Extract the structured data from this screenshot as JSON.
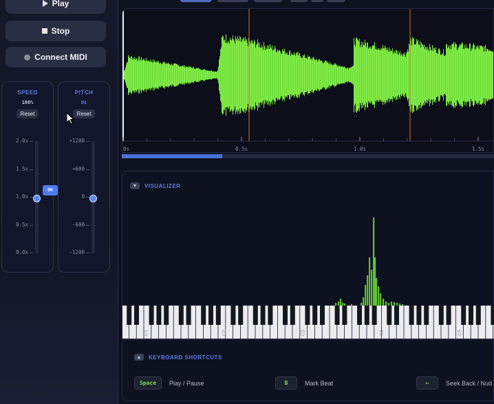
{
  "transport": {
    "play_label": "Play",
    "stop_label": "Stop",
    "midi_label": "Connect MIDI"
  },
  "speed": {
    "title": "SPEED",
    "value": "100%",
    "reset_label": "Reset",
    "ticks": [
      "2.0x",
      "1.5x",
      "1.0x",
      "0.5x",
      "0.0x"
    ],
    "level": 0.5
  },
  "pitch": {
    "title": "PITCH",
    "value": "0¢",
    "reset_label": "Reset",
    "badge": "0¢",
    "ticks": [
      "+1200",
      "+600",
      "0",
      "-600",
      "-1200"
    ],
    "level": 0.5
  },
  "waveform": {
    "time_labels": [
      "0s",
      "0.5s",
      "1.0s",
      "1.5s"
    ],
    "progress": 0.27,
    "colors": {
      "wave": "#6fdf3a",
      "wave_light": "#8ff04f",
      "marker": "#d9782a"
    }
  },
  "visualizer": {
    "title": "VISUALIZER",
    "toggle": "▼",
    "octave_labels": [
      "C1",
      "C2",
      "C3",
      "C4",
      "C5"
    ]
  },
  "shortcuts": {
    "title": "KEYBOARD SHORTCUTS",
    "toggle": "▲",
    "items": [
      {
        "key": "Space",
        "desc": "Play / Pause"
      },
      {
        "key": "B",
        "desc": "Mark Beat"
      },
      {
        "key": "←",
        "desc": "Seek Back / Nud"
      }
    ]
  },
  "colors": {
    "accent": "#5b7ee8",
    "green": "#7ee14a",
    "background": "#0f1220"
  }
}
